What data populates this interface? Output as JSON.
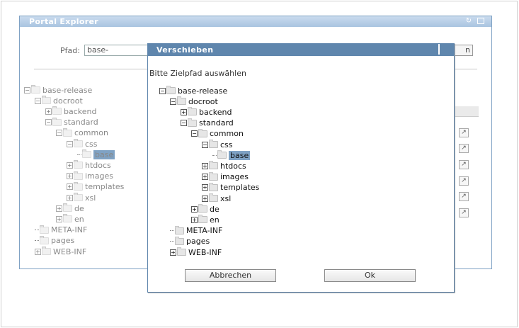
{
  "explorer": {
    "title": "Portal Explorer",
    "path_label": "Pfad:",
    "path_value": "base-release\\doc",
    "path_button_fragment": "n",
    "tree": [
      {
        "label": "base-release",
        "toggle": "−",
        "depth": 0
      },
      {
        "label": "docroot",
        "toggle": "−",
        "depth": 1
      },
      {
        "label": "backend",
        "toggle": "+",
        "depth": 2
      },
      {
        "label": "standard",
        "toggle": "−",
        "depth": 2
      },
      {
        "label": "common",
        "toggle": "−",
        "depth": 3
      },
      {
        "label": "css",
        "toggle": "−",
        "depth": 4
      },
      {
        "label": "base",
        "toggle": "",
        "depth": 5,
        "selected": true
      },
      {
        "label": "htdocs",
        "toggle": "+",
        "depth": 4
      },
      {
        "label": "images",
        "toggle": "+",
        "depth": 4
      },
      {
        "label": "templates",
        "toggle": "+",
        "depth": 4
      },
      {
        "label": "xsl",
        "toggle": "+",
        "depth": 4
      },
      {
        "label": "de",
        "toggle": "+",
        "depth": 3
      },
      {
        "label": "en",
        "toggle": "+",
        "depth": 3
      },
      {
        "label": "META-INF",
        "toggle": "",
        "depth": 1
      },
      {
        "label": "pages",
        "toggle": "",
        "depth": 1
      },
      {
        "label": "WEB-INF",
        "toggle": "+",
        "depth": 1
      }
    ]
  },
  "dialog": {
    "title": "Verschieben",
    "prompt": "Bitte Zielpfad auswählen",
    "cancel_label": "Abbrechen",
    "ok_label": "Ok",
    "tree": [
      {
        "label": "base-release",
        "toggle": "−",
        "depth": 0
      },
      {
        "label": "docroot",
        "toggle": "−",
        "depth": 1
      },
      {
        "label": "backend",
        "toggle": "+",
        "depth": 2
      },
      {
        "label": "standard",
        "toggle": "−",
        "depth": 2
      },
      {
        "label": "common",
        "toggle": "−",
        "depth": 3
      },
      {
        "label": "css",
        "toggle": "−",
        "depth": 4
      },
      {
        "label": "base",
        "toggle": "",
        "depth": 5,
        "selected": true
      },
      {
        "label": "htdocs",
        "toggle": "+",
        "depth": 4
      },
      {
        "label": "images",
        "toggle": "+",
        "depth": 4
      },
      {
        "label": "templates",
        "toggle": "+",
        "depth": 4
      },
      {
        "label": "xsl",
        "toggle": "+",
        "depth": 4
      },
      {
        "label": "de",
        "toggle": "+",
        "depth": 3
      },
      {
        "label": "en",
        "toggle": "+",
        "depth": 3
      },
      {
        "label": "META-INF",
        "toggle": "",
        "depth": 1
      },
      {
        "label": "pages",
        "toggle": "",
        "depth": 1
      },
      {
        "label": "WEB-INF",
        "toggle": "+",
        "depth": 1
      }
    ]
  },
  "icons": {
    "refresh": "refresh-icon",
    "maximize": "maximize-icon",
    "edit": "edit-arrow-icon",
    "folder": "folder-icon"
  },
  "colors": {
    "dialog_title_bg": "#5f86ad",
    "explorer_title_bg": "#a9c4e0",
    "selection": "#7fa2c4"
  }
}
